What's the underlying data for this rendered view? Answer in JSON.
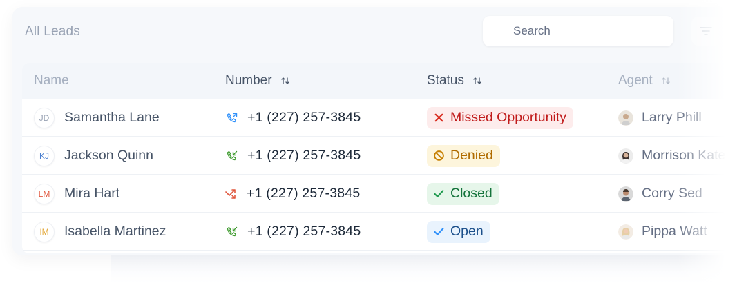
{
  "header": {
    "title": "All Leads",
    "search_placeholder": "Search"
  },
  "columns": [
    {
      "label": "Name",
      "sortable": false
    },
    {
      "label": "Number",
      "sortable": true
    },
    {
      "label": "Status",
      "sortable": true
    },
    {
      "label": "Agent",
      "sortable": true
    }
  ],
  "rows": [
    {
      "initials": "JD",
      "initials_color": "#98a2b3",
      "name": "Samantha Lane",
      "call_icon": "incoming-call-icon",
      "call_color": "#2e90fa",
      "number": "+1 (227) 257-3845",
      "status": "Missed Opportunity",
      "status_icon": "x-icon",
      "status_color": "#c01b1b",
      "status_bg": "#fdecec",
      "agent": "Larry Phill",
      "agent_avatar": "agent-avatar-larry"
    },
    {
      "initials": "KJ",
      "initials_color": "#4a7fd0",
      "name": "Jackson Quinn",
      "call_icon": "outgoing-call-icon",
      "call_color": "#3f9b2f",
      "number": "+1 (227) 257-3845",
      "status": "Denied",
      "status_icon": "ban-icon",
      "status_color": "#b06b00",
      "status_bg": "#fdf5dc",
      "agent": "Morrison Kate",
      "agent_avatar": "agent-avatar-morrison"
    },
    {
      "initials": "LM",
      "initials_color": "#e1583f",
      "name": "Mira Hart",
      "call_icon": "missed-call-arrow-icon",
      "call_color": "#e1583f",
      "number": "+1 (227) 257-3845",
      "status": "Closed",
      "status_icon": "check-icon",
      "status_color": "#14733b",
      "status_bg": "#e6f6ea",
      "agent": "Corry Sed",
      "agent_avatar": "agent-avatar-corry"
    },
    {
      "initials": "IM",
      "initials_color": "#e3a93b",
      "name": "Isabella Martinez",
      "call_icon": "outgoing-call-icon",
      "call_color": "#3f9b2f",
      "number": "+1 (227) 257-3845",
      "status": "Open",
      "status_icon": "check-icon",
      "status_color": "#1b4f8a",
      "status_bg": "#e9f3fd",
      "agent": "Pippa Watt",
      "agent_avatar": "agent-avatar-pippa"
    }
  ]
}
